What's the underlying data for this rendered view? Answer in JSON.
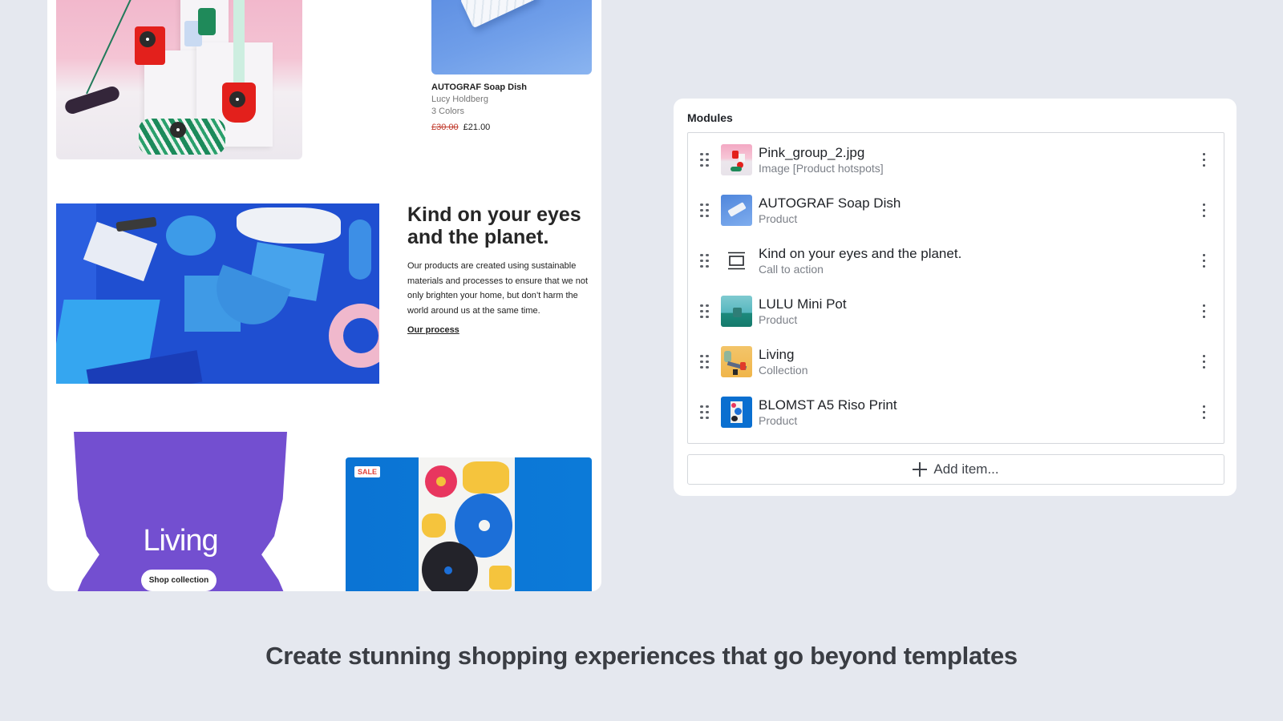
{
  "preview": {
    "hotspot_image": {
      "alt": "Pink group product scene",
      "hotspot_count": 3
    },
    "product_card": {
      "title": "AUTOGRAF Soap Dish",
      "designer": "Lucy Holdberg",
      "variants": "3 Colors",
      "price_original": "£30.00",
      "price_sale": "£21.00"
    },
    "cta": {
      "title": "Kind on your eyes and the planet.",
      "body": "Our products are created using sustainable materials and processes to ensure that we not only brighten your home, but don’t harm the world around us at the same time.",
      "link_label": "Our process"
    },
    "collection": {
      "title": "Living",
      "button_label": "Shop collection",
      "color": "#734fd0"
    },
    "print_card": {
      "badge": "SALE"
    }
  },
  "modules": {
    "label": "Modules",
    "items": [
      {
        "title": "Pink_group_2.jpg",
        "subtitle": "Image [Product hotspots]",
        "thumb": "pink-scene-thumbnail"
      },
      {
        "title": "AUTOGRAF Soap Dish",
        "subtitle": "Product",
        "thumb": "soap-dish-thumbnail"
      },
      {
        "title": "Kind on your eyes and the planet.",
        "subtitle": "Call to action",
        "thumb": "call-to-action-icon"
      },
      {
        "title": "LULU Mini Pot",
        "subtitle": "Product",
        "thumb": "mini-pot-thumbnail"
      },
      {
        "title": "Living",
        "subtitle": "Collection",
        "thumb": "living-collection-thumbnail"
      },
      {
        "title": "BLOMST A5 Riso Print",
        "subtitle": "Product",
        "thumb": "riso-print-thumbnail"
      }
    ],
    "add_item_label": "Add item..."
  },
  "tagline": "Create stunning shopping experiences that go beyond templates"
}
